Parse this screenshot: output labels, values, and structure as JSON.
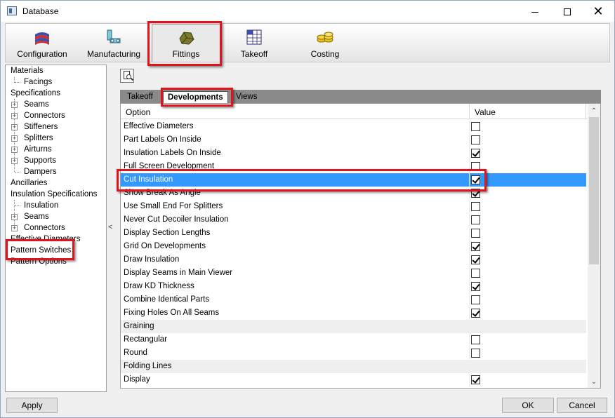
{
  "window": {
    "title": "Database",
    "close_glyph": "✕"
  },
  "ribbon": {
    "tabs": [
      {
        "label": "Configuration",
        "icon": "books-icon"
      },
      {
        "label": "Manufacturing",
        "icon": "machine-icon"
      },
      {
        "label": "Fittings",
        "icon": "fitting-icon",
        "active": true
      },
      {
        "label": "Takeoff",
        "icon": "grid-sheet-icon"
      },
      {
        "label": "Costing",
        "icon": "coins-icon"
      }
    ]
  },
  "tree": {
    "items": [
      {
        "label": "Materials",
        "level": 0,
        "expander": false
      },
      {
        "label": "Facings",
        "level": 1,
        "expander": false
      },
      {
        "label": "Specifications",
        "level": 0,
        "expander": false
      },
      {
        "label": "Seams",
        "level": 1,
        "expander": true
      },
      {
        "label": "Connectors",
        "level": 1,
        "expander": true
      },
      {
        "label": "Stiffeners",
        "level": 1,
        "expander": true
      },
      {
        "label": "Splitters",
        "level": 1,
        "expander": true
      },
      {
        "label": "Airturns",
        "level": 1,
        "expander": true
      },
      {
        "label": "Supports",
        "level": 1,
        "expander": true
      },
      {
        "label": "Dampers",
        "level": 1,
        "expander": false
      },
      {
        "label": "Ancillaries",
        "level": 0,
        "expander": false
      },
      {
        "label": "Insulation Specifications",
        "level": 0,
        "expander": false
      },
      {
        "label": "Insulation",
        "level": 1,
        "expander": false
      },
      {
        "label": "Seams",
        "level": 1,
        "expander": true
      },
      {
        "label": "Connectors",
        "level": 1,
        "expander": true
      },
      {
        "label": "Effective Diameters",
        "level": 0,
        "expander": false
      },
      {
        "label": "Pattern Switches",
        "level": 0,
        "expander": false
      },
      {
        "label": "Pattern Options",
        "level": 0,
        "expander": false
      }
    ],
    "collapse_glyph": "<"
  },
  "subtabs": [
    "Takeoff",
    "Developments",
    "Views"
  ],
  "grid": {
    "col_option": "Option",
    "col_value": "Value",
    "rows": [
      {
        "label": "Effective Diameters",
        "checked": false
      },
      {
        "label": "Part Labels On Inside",
        "checked": false
      },
      {
        "label": "Insulation Labels On Inside",
        "checked": true
      },
      {
        "label": "Full Screen Development",
        "checked": false
      },
      {
        "label": "Cut Insulation",
        "checked": true,
        "selected": true
      },
      {
        "label": "Show Break As Angle",
        "checked": true
      },
      {
        "label": "Use Small End For Splitters",
        "checked": false
      },
      {
        "label": "Never Cut Decoiler Insulation",
        "checked": false
      },
      {
        "label": "Display Section Lengths",
        "checked": false
      },
      {
        "label": "Grid On Developments",
        "checked": true
      },
      {
        "label": "Draw Insulation",
        "checked": true
      },
      {
        "label": "Display Seams in Main Viewer",
        "checked": false
      },
      {
        "label": "Draw KD Thickness",
        "checked": true
      },
      {
        "label": "Combine Identical Parts",
        "checked": false
      },
      {
        "label": "Fixing Holes On All Seams",
        "checked": true
      },
      {
        "label": "Graining",
        "section": true
      },
      {
        "label": "Rectangular",
        "checked": false
      },
      {
        "label": "Round",
        "checked": false
      },
      {
        "label": "Folding Lines",
        "section": true
      },
      {
        "label": "Display",
        "checked": true
      }
    ]
  },
  "buttons": {
    "apply": "Apply",
    "ok": "OK",
    "cancel": "Cancel"
  },
  "colors": {
    "selection": "#3399ff",
    "highlight_box": "#e0141c"
  }
}
